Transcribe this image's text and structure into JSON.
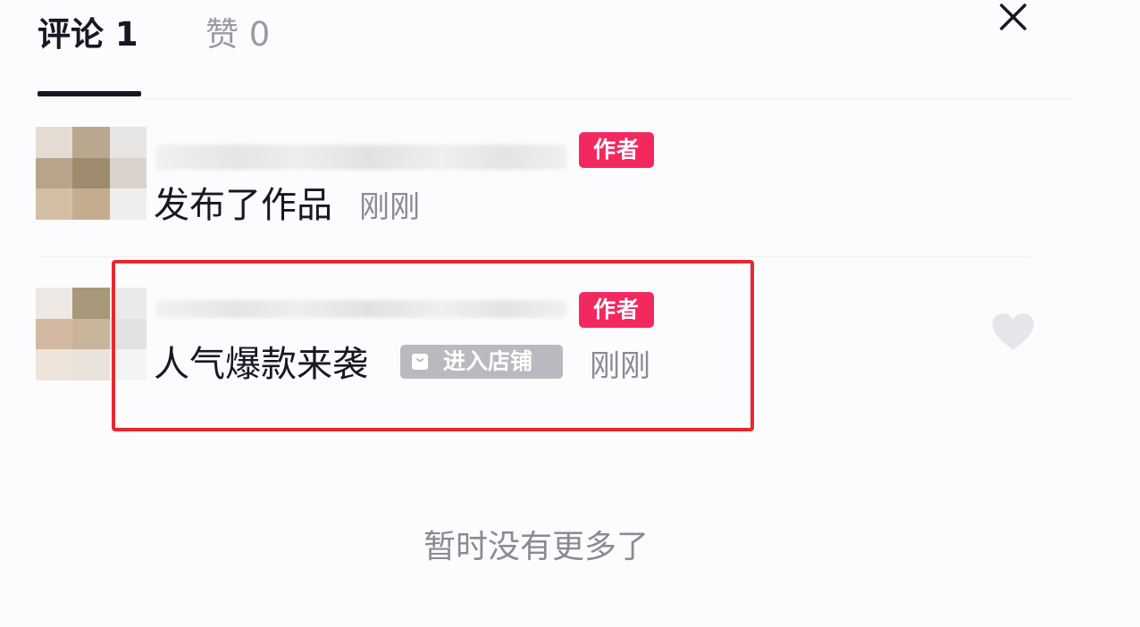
{
  "tabs": {
    "comments": "评论 1",
    "likes": "赞 0"
  },
  "comments": [
    {
      "badge": "作者",
      "text": "发布了作品",
      "time": "刚刚"
    },
    {
      "badge": "作者",
      "text": "人气爆款来袭",
      "shop_link": "进入店铺",
      "time": "刚刚"
    }
  ],
  "footer": "暂时没有更多了",
  "icons": {
    "close": "close-icon",
    "like": "heart-icon",
    "shop": "shopping-bag-icon"
  },
  "colors": {
    "author_badge": "#f2285f",
    "highlight": "#e8282f",
    "secondary_text": "#8a8b91",
    "primary_text": "#161823"
  }
}
